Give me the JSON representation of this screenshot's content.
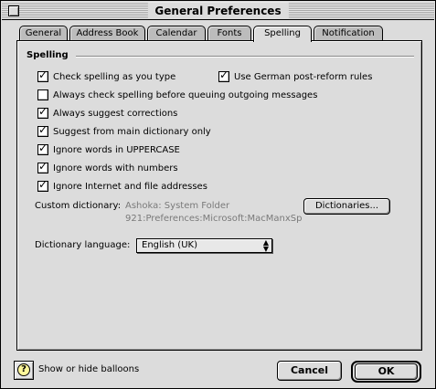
{
  "window": {
    "title": "General Preferences"
  },
  "tabs": [
    {
      "label": "General",
      "active": false
    },
    {
      "label": "Address Book",
      "active": false
    },
    {
      "label": "Calendar",
      "active": false
    },
    {
      "label": "Fonts",
      "active": false
    },
    {
      "label": "Spelling",
      "active": true
    },
    {
      "label": "Notification",
      "active": false
    }
  ],
  "spelling": {
    "section_title": "Spelling",
    "options": [
      {
        "label": "Check spelling as you type",
        "checked": true
      },
      {
        "label": "Use German post-reform rules",
        "checked": true
      },
      {
        "label": "Always check spelling before queuing outgoing messages",
        "checked": false
      },
      {
        "label": "Always suggest corrections",
        "checked": true
      },
      {
        "label": "Suggest from main dictionary only",
        "checked": true
      },
      {
        "label": "Ignore words in UPPERCASE",
        "checked": true
      },
      {
        "label": "Ignore words with numbers",
        "checked": true
      },
      {
        "label": "Ignore Internet and file addresses",
        "checked": true
      }
    ],
    "custom_dictionary": {
      "label": "Custom dictionary:",
      "path_line1": "Ashoka: System Folder",
      "path_line2": "921:Preferences:Microsoft:MacManxSp",
      "button_label": "Dictionaries..."
    },
    "dictionary_language": {
      "label": "Dictionary language:",
      "selected": "English (UK)"
    }
  },
  "footer": {
    "help_label": "Show or hide balloons",
    "cancel_label": "Cancel",
    "ok_label": "OK"
  },
  "icons": {
    "close": "close-box-icon",
    "help": "balloon-help-icon",
    "popup": "up-down-arrows-icon",
    "check": "checkmark-icon"
  }
}
